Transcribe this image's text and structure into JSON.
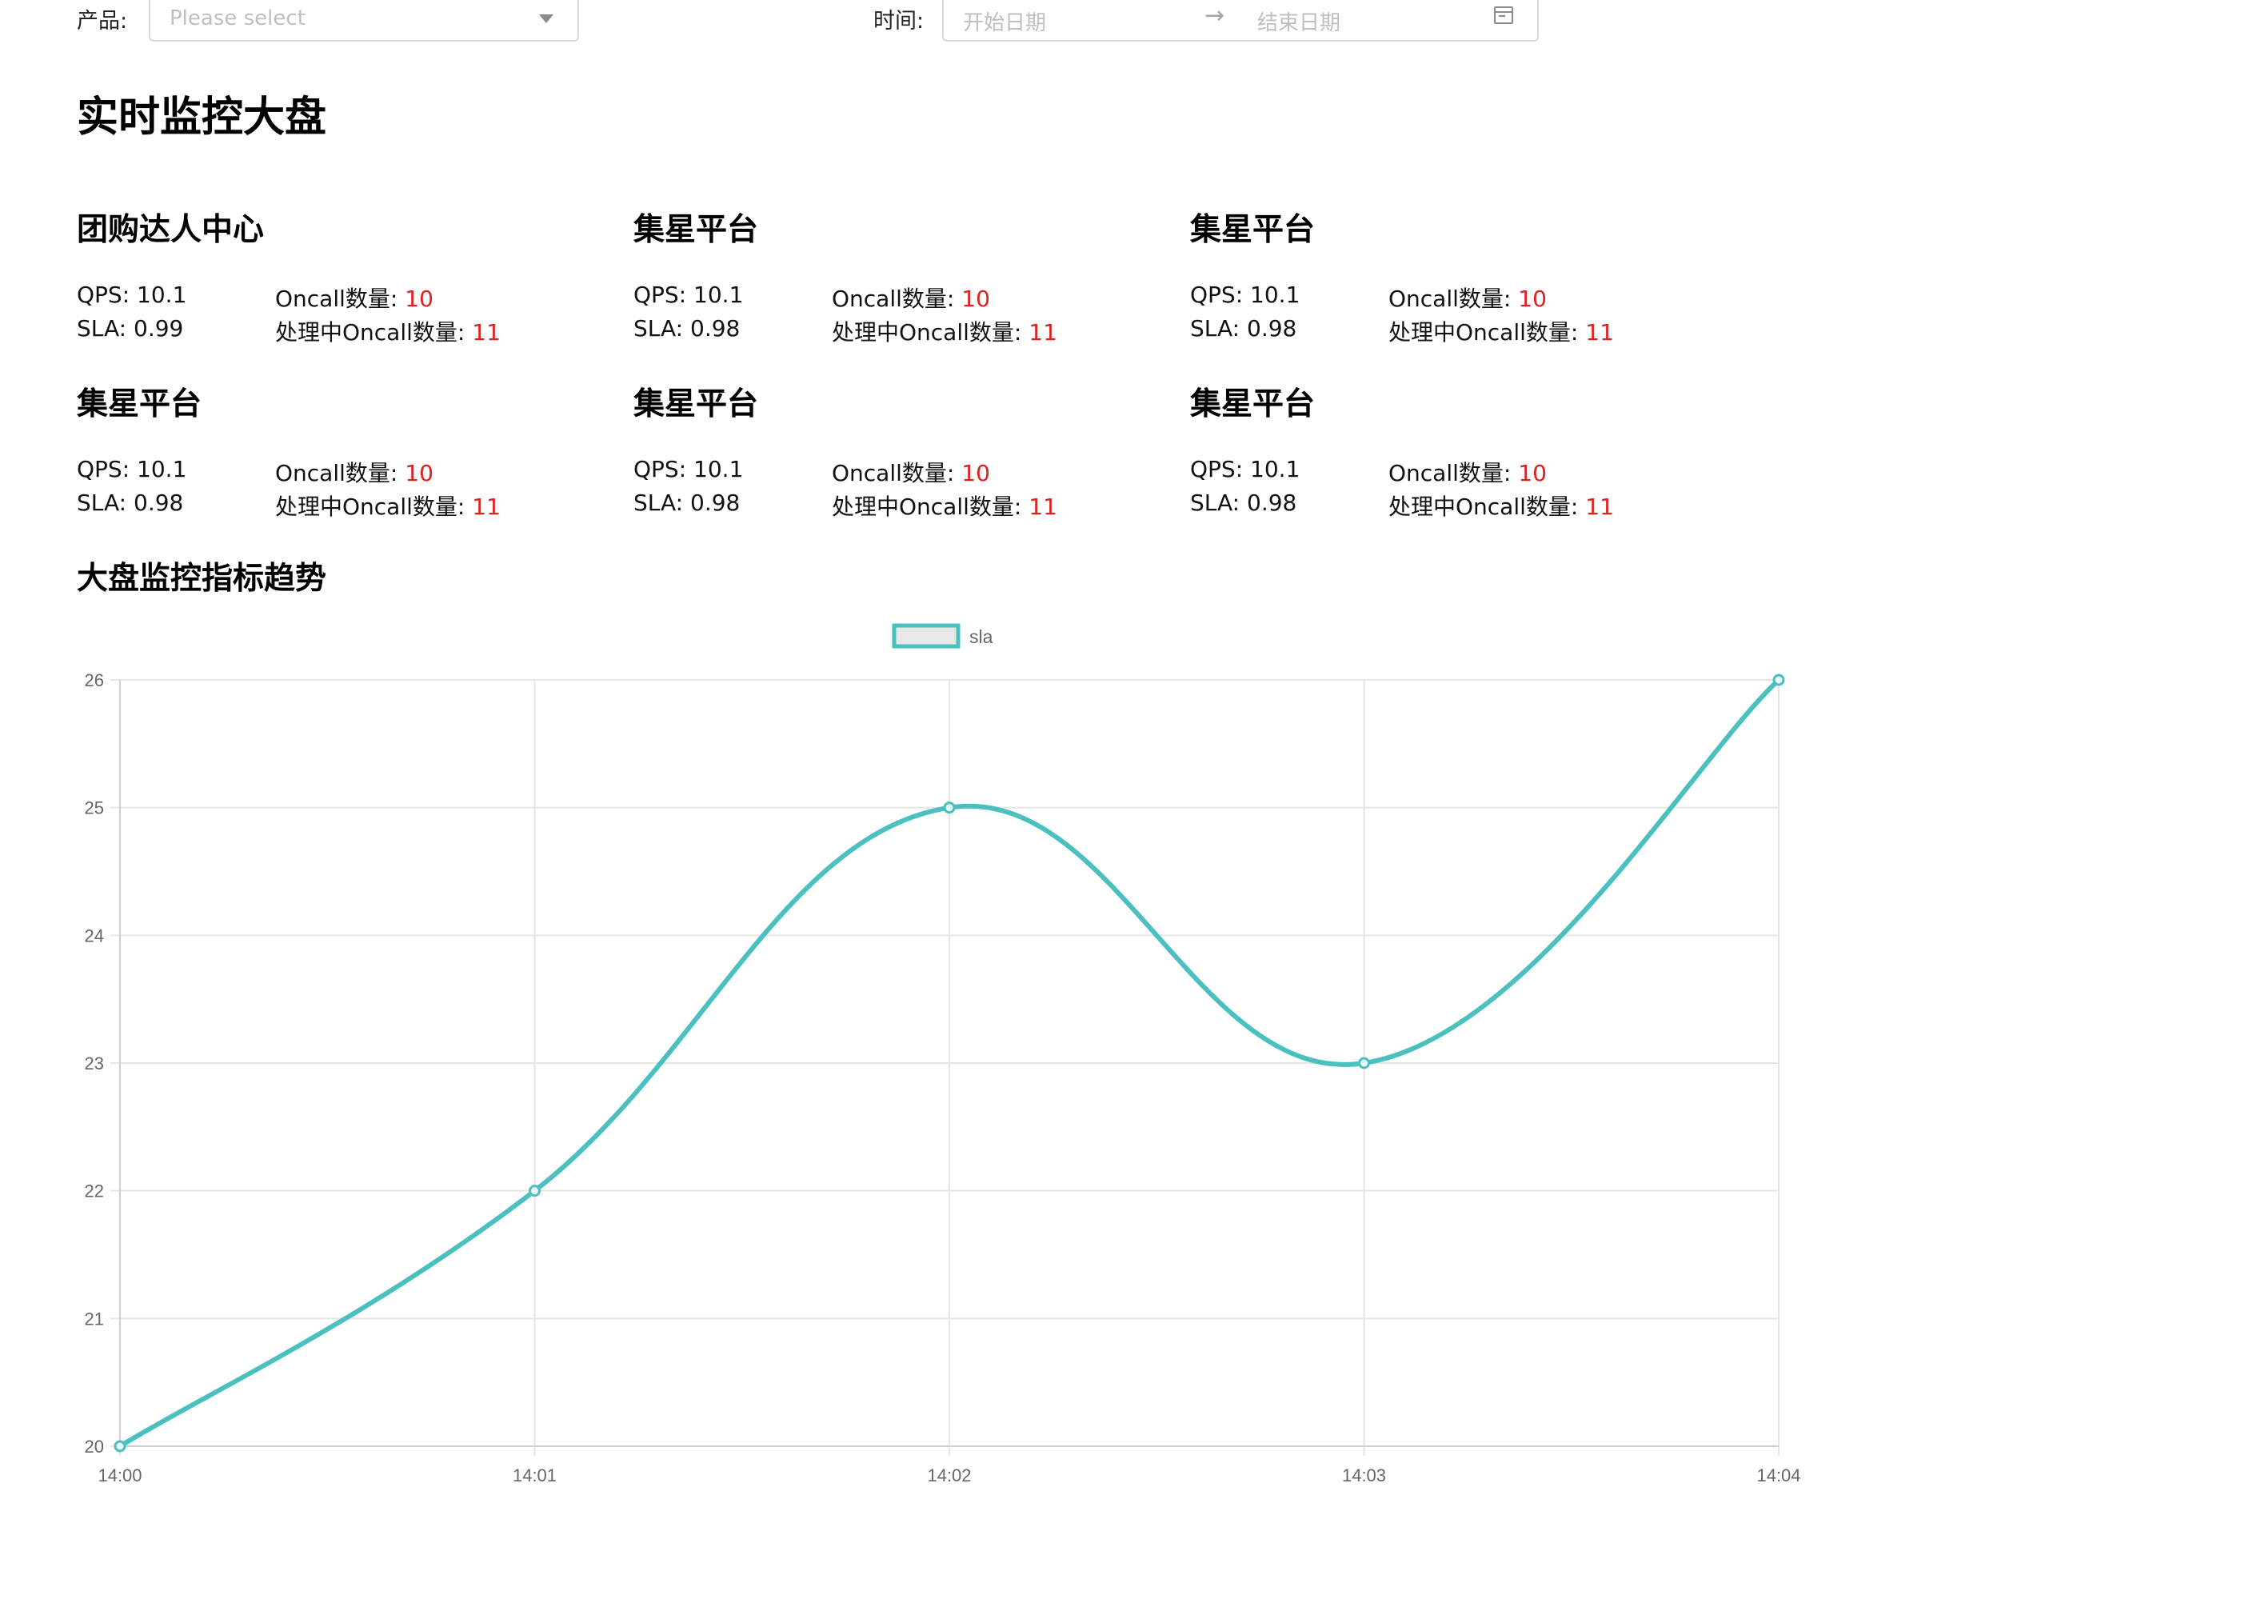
{
  "filters": {
    "product_label": "产品:",
    "product_placeholder": "Please select",
    "time_label": "时间:",
    "start_placeholder": "开始日期",
    "end_placeholder": "结束日期",
    "arrow": "→"
  },
  "page_title": "实时监控大盘",
  "cards": [
    {
      "title": "团购达人中心",
      "qps_label": "QPS:",
      "qps": "10.1",
      "sla_label": "SLA:",
      "sla": "0.99",
      "oncall_label": "Oncall数量:",
      "oncall": "10",
      "processing_label": "处理中Oncall数量:",
      "processing": "11"
    },
    {
      "title": "集星平台",
      "qps_label": "QPS:",
      "qps": "10.1",
      "sla_label": "SLA:",
      "sla": "0.98",
      "oncall_label": "Oncall数量:",
      "oncall": "10",
      "processing_label": "处理中Oncall数量:",
      "processing": "11"
    },
    {
      "title": "集星平台",
      "qps_label": "QPS:",
      "qps": "10.1",
      "sla_label": "SLA:",
      "sla": "0.98",
      "oncall_label": "Oncall数量:",
      "oncall": "10",
      "processing_label": "处理中Oncall数量:",
      "processing": "11"
    },
    {
      "title": "集星平台",
      "qps_label": "QPS:",
      "qps": "10.1",
      "sla_label": "SLA:",
      "sla": "0.98",
      "oncall_label": "Oncall数量:",
      "oncall": "10",
      "processing_label": "处理中Oncall数量:",
      "processing": "11"
    },
    {
      "title": "集星平台",
      "qps_label": "QPS:",
      "qps": "10.1",
      "sla_label": "SLA:",
      "sla": "0.98",
      "oncall_label": "Oncall数量:",
      "oncall": "10",
      "processing_label": "处理中Oncall数量:",
      "processing": "11"
    },
    {
      "title": "集星平台",
      "qps_label": "QPS:",
      "qps": "10.1",
      "sla_label": "SLA:",
      "sla": "0.98",
      "oncall_label": "Oncall数量:",
      "oncall": "10",
      "processing_label": "处理中Oncall数量:",
      "processing": "11"
    }
  ],
  "section_title": "大盘监控指标趋势",
  "colors": {
    "series": "#4bc0c0",
    "legend_fill": "#e8e8e8",
    "grid": "#e6e6e6",
    "alert": "#e02020"
  },
  "chart_data": {
    "type": "line",
    "x": [
      "14:00",
      "14:01",
      "14:02",
      "14:03",
      "14:04"
    ],
    "series": [
      {
        "name": "sla",
        "values": [
          20,
          22,
          25,
          23,
          26
        ]
      }
    ],
    "yticks": [
      20,
      21,
      22,
      23,
      24,
      25,
      26
    ],
    "ylim": [
      20,
      26
    ],
    "legend": "top-center",
    "grid": true,
    "smooth": true
  }
}
